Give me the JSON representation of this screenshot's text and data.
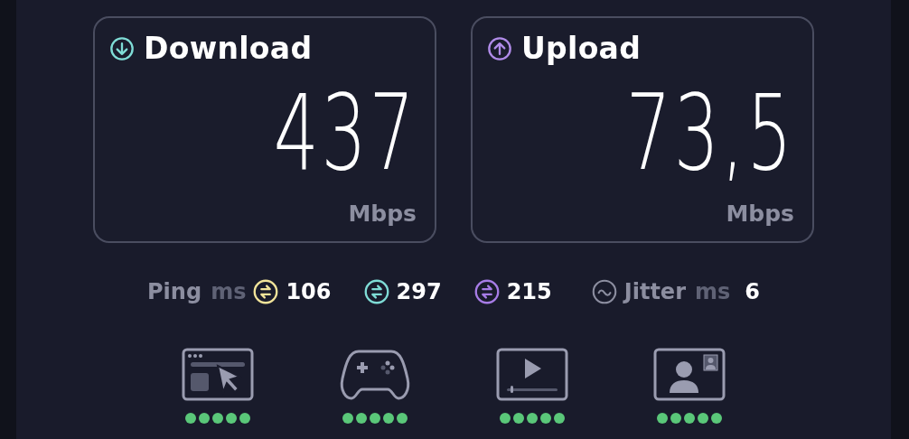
{
  "results": [
    {
      "kind": "download",
      "title": "Download",
      "value": "437",
      "unit": "Mbps",
      "color": "#7fdcd6"
    },
    {
      "kind": "upload",
      "title": "Upload",
      "value": "73,5",
      "unit": "Mbps",
      "color": "#b08be8"
    }
  ],
  "ping": {
    "label": "Ping",
    "unit": "ms",
    "values": [
      {
        "value": "106",
        "color": "#f2e49a"
      },
      {
        "value": "297",
        "color": "#7fdcd6"
      },
      {
        "value": "215",
        "color": "#a77ce6"
      }
    ]
  },
  "jitter": {
    "label": "Jitter",
    "unit": "ms",
    "value": "6"
  },
  "usage": [
    {
      "kind": "browsing",
      "stars": 5
    },
    {
      "kind": "gaming",
      "stars": 5
    },
    {
      "kind": "streaming",
      "stars": 5
    },
    {
      "kind": "video-call",
      "stars": 5
    }
  ]
}
